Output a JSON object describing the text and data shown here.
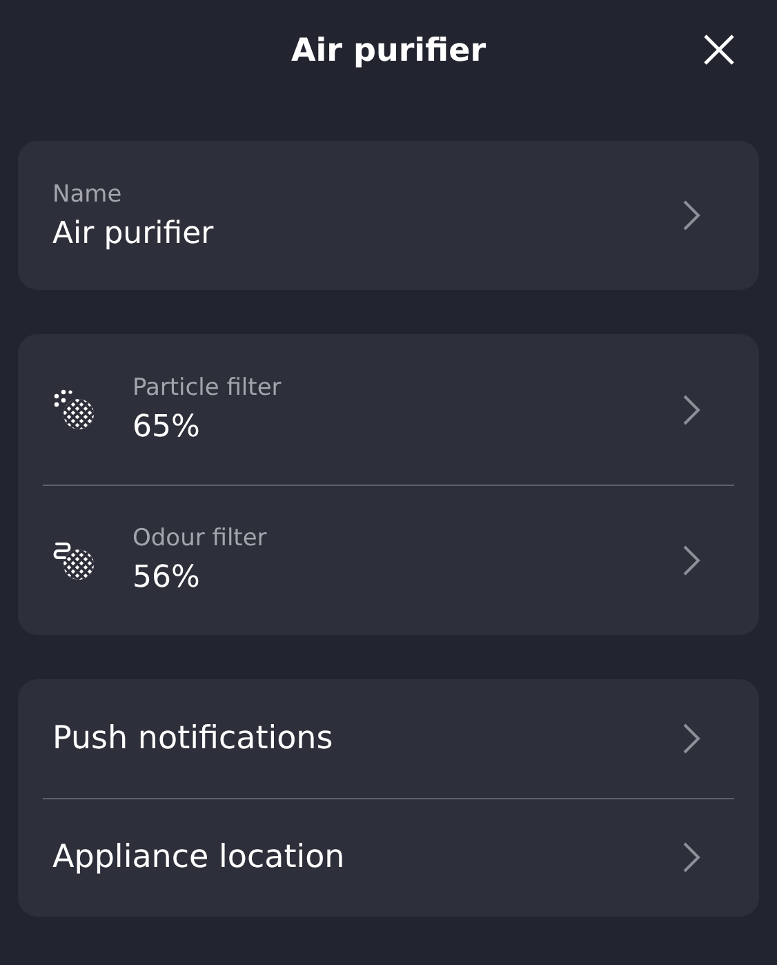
{
  "header": {
    "title": "Air purifier"
  },
  "name_field": {
    "label": "Name",
    "value": "Air purifier"
  },
  "filters": [
    {
      "kind": "particle",
      "label": "Particle filter",
      "value": "65%"
    },
    {
      "kind": "odour",
      "label": "Odour filter",
      "value": "56%"
    }
  ],
  "settings": [
    {
      "label": "Push notifications"
    },
    {
      "label": "Appliance location"
    }
  ]
}
